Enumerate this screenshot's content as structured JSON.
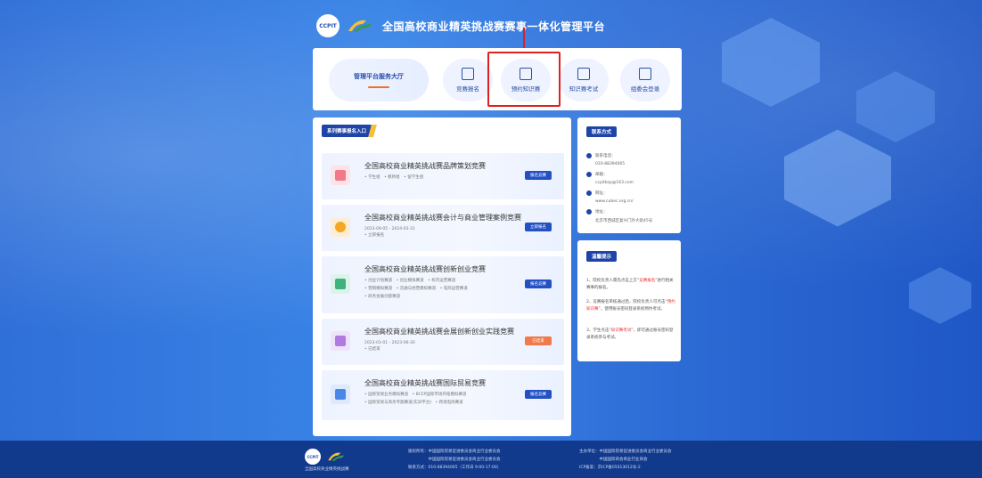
{
  "header": {
    "ccpit_logo": "CCPIT",
    "cubec_logo": "CUBEC",
    "title": "全国高校商业精英挑战赛赛事一体化管理平台"
  },
  "nav": {
    "hall_label": "管理平台服务大厅",
    "items": [
      {
        "label": "竞赛报名",
        "icon": "checkbox-icon"
      },
      {
        "label": "预约知识赛",
        "icon": "calendar-icon"
      },
      {
        "label": "知识赛考试",
        "icon": "edit-icon"
      },
      {
        "label": "组委会登录",
        "icon": "login-icon"
      }
    ]
  },
  "main": {
    "section_tag": "系列赛事报名入口",
    "competitions": [
      {
        "title": "全国高校商业精英挑战赛品牌策划竞赛",
        "sub1": "• 学生组　• 教师组　• 留学生组",
        "sub2": "",
        "button": "报名竞赛",
        "button_color": "#2350c2",
        "icon_color": "#f07a8a",
        "icon_bg": "#fde3e7"
      },
      {
        "title": "全国高校商业精英挑战赛会计与商业管理案例竞赛",
        "sub1": "2023-09-05 - 2024-03-31",
        "sub2": "• 立即报名",
        "button": "立即报名",
        "button_color": "#2350c2",
        "icon_color": "#f5a623",
        "icon_bg": "#fdeed3"
      },
      {
        "title": "全国高校商业精英挑战赛创新创业竞赛",
        "sub1": "• 创业计划赛道　• 创业模拟赛道　• 校内运营赛道",
        "sub2": "• 营销模拟赛道　• 流通与经营模拟赛道　• 电商运营赛道",
        "sub3": "• 商务会展创意赛道",
        "button": "报名竞赛",
        "button_color": "#2350c2",
        "icon_color": "#3fb27f",
        "icon_bg": "#dcf3e7"
      },
      {
        "title": "全国高校商业精英挑战赛会展创新创业实践竞赛",
        "sub1": "2023-01-01 - 2023-06-30",
        "sub2": "• 已结束",
        "button": "已结束",
        "button_color": "#f07a4a",
        "icon_color": "#b07ae0",
        "icon_bg": "#efe3fb"
      },
      {
        "title": "全国高校商业精英挑战赛国际贸易竞赛",
        "sub1": "• 国际贸易业务模拟赛道　• BCEP国际市场开拓模拟赛道",
        "sub2": "• 国际贸易与商务专题赛道(实训平台)　• 跨境电商赛道",
        "button": "报名竞赛",
        "button_color": "#2350c2",
        "icon_color": "#4a86e8",
        "icon_bg": "#dde9fc"
      }
    ]
  },
  "contact": {
    "tag": "联系方式",
    "phone_label": "联系电话：",
    "phone": "010-88394065",
    "email_label": "邮箱：",
    "email": "ccpitbsp@163.com",
    "web_label": "网址：",
    "web": "www.cubec.org.cn/",
    "addr_label": "地址：",
    "addr": "北京市西城区复兴门外大街45号"
  },
  "warm": {
    "tag": "温馨提示",
    "tip1_a": "1、院校负责人需先点击上方“",
    "tip1_hl": "竞赛报名",
    "tip1_b": "”进行相关赛事的报名。",
    "tip2_a": "2、竞赛报名审核通过后，院校负责人可点击“",
    "tip2_hl": "预约知识赛",
    "tip2_b": "”，使用账号密码登录系统预约考试。",
    "tip3_a": "3、学生点击“",
    "tip3_hl": "知识赛考试",
    "tip3_b": "”，即可通过账号密码登录系统参与考试。"
  },
  "footer": {
    "caption": "全国高校商业精英挑战赛",
    "col1": [
      "版权所有：中国国际贸易促进委员会商业行业委员会",
      "　　　　　中国国际贸易促进委员会商业行业委员会",
      "联系方式：010-88394065（工作日 9:00-17:00）"
    ],
    "col2": [
      "主办单位：中国国际贸易促进委员会商业行业委员会",
      "　　　　　中国国际商会商业行业商会",
      "ICP备案：京ICP备05013012号-2"
    ]
  }
}
